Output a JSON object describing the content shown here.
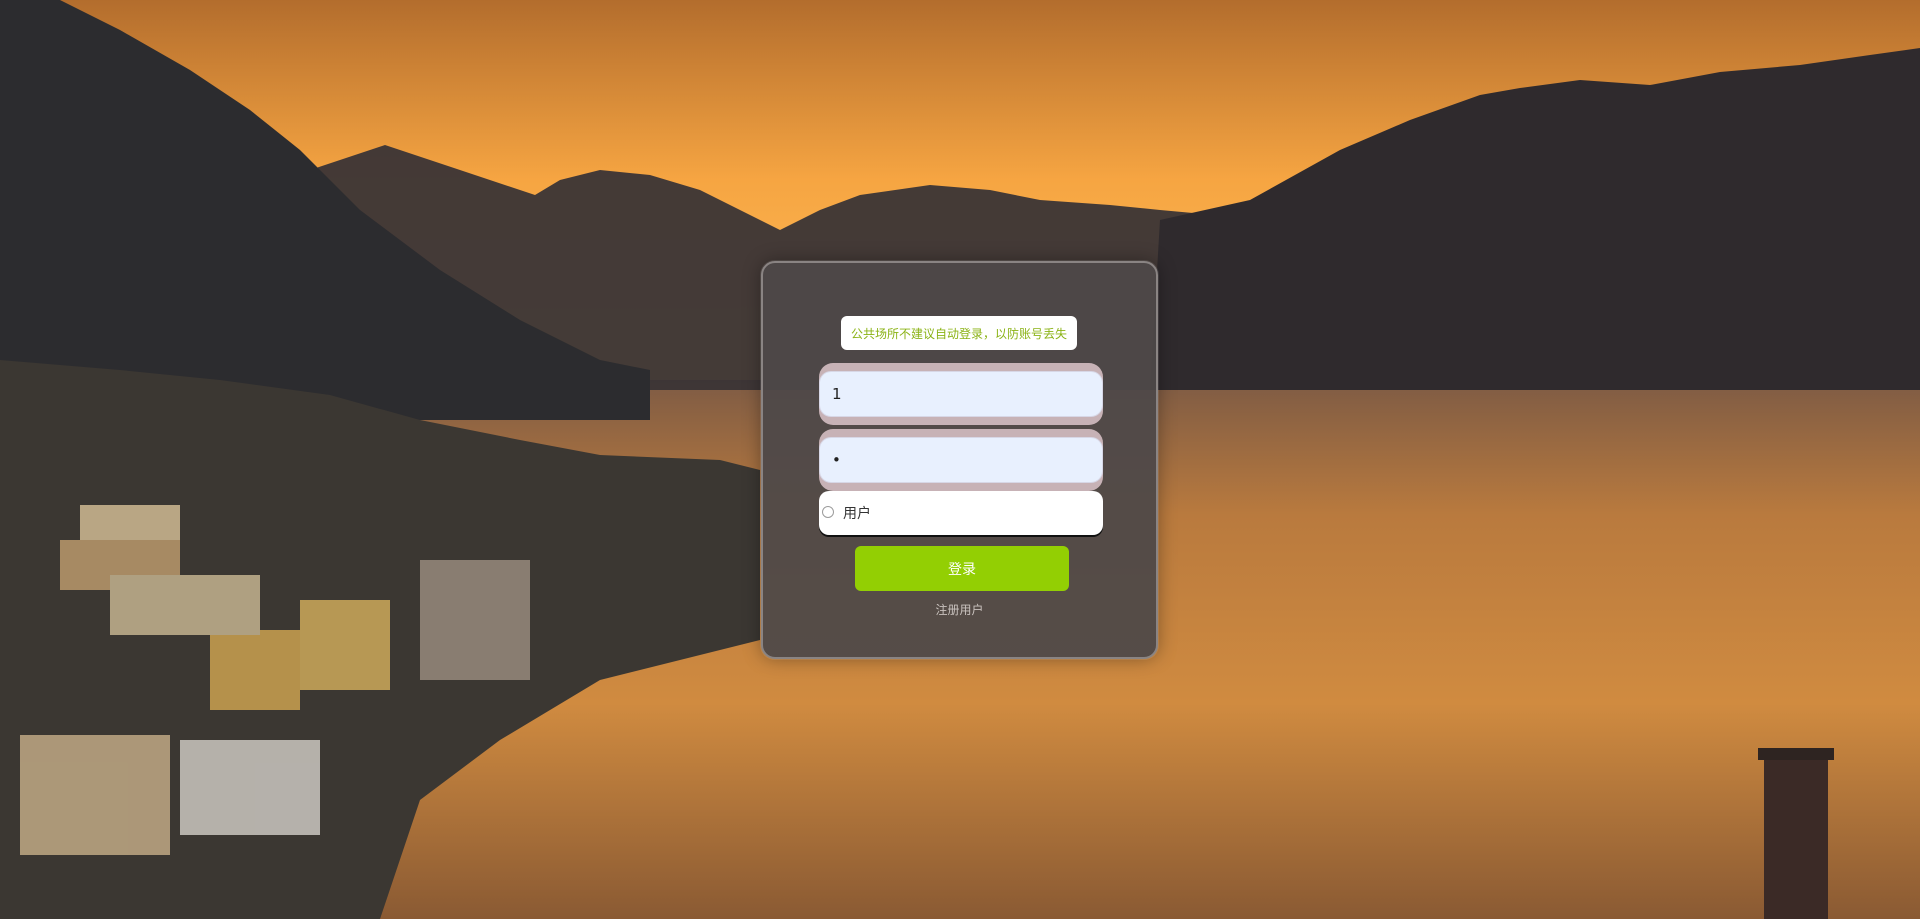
{
  "page": {
    "background_scene": "sunset-lake-village-background"
  },
  "login": {
    "notice": "公共场所不建议自动登录，以防账号丢失",
    "username_value": "1",
    "password_value": "•",
    "role_label": "用户",
    "button_label": "登录",
    "register_link": "注册用户"
  },
  "colors": {
    "accent": "#93cf03",
    "notice_text": "#8bb316",
    "card_bg": "#4e4848"
  }
}
